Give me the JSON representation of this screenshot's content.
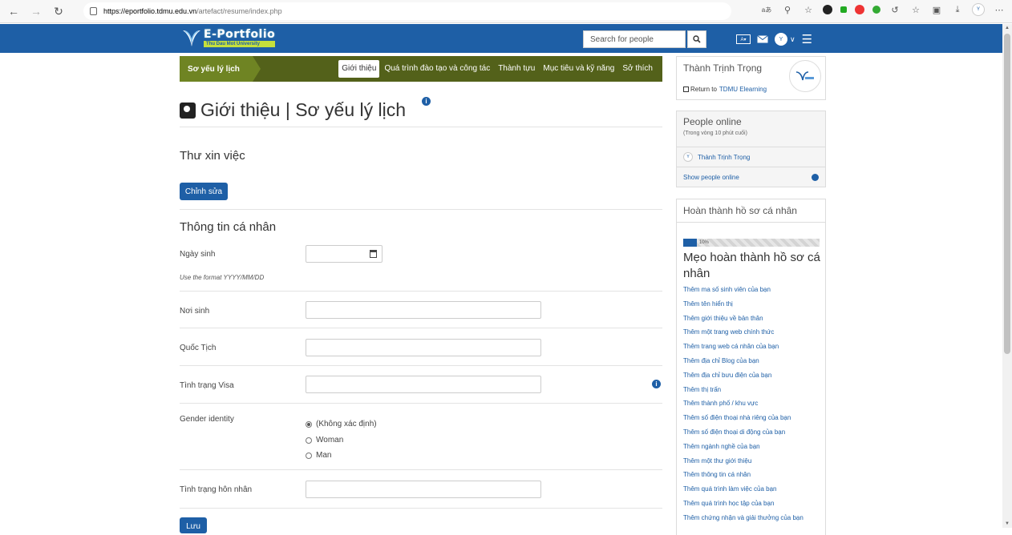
{
  "browser": {
    "url_host": "https://eportfolio.tdmu.edu.vn",
    "url_path": "/artefact/resume/index.php",
    "icons": [
      "back-icon",
      "forward-icon",
      "reload-icon",
      "lock-icon",
      "read-aloud-icon",
      "zoom-icon",
      "star-icon",
      "extensions-icon",
      "favorites-icon",
      "collections-icon",
      "downloads-icon",
      "profile-icon",
      "more-icon"
    ]
  },
  "site": {
    "logo_title": "E-Portfolio",
    "logo_sub": "Thu Dau Mot University",
    "search_placeholder": "Search for people"
  },
  "tabs": {
    "title": "Sơ yếu lý lịch",
    "items": [
      "Giới thiệu",
      "Quá trình đào tạo và công tác",
      "Thành tựu",
      "Mục tiêu và kỹ năng",
      "Sở thích"
    ],
    "active": 0
  },
  "main": {
    "page_title": "Giới thiệu | Sơ yếu lý lịch",
    "cover_letter_heading": "Thư xin việc",
    "edit_label": "Chỉnh sửa",
    "personal_heading": "Thông tin cá nhân",
    "fields": {
      "birthdate_label": "Ngày sinh",
      "birthdate_hint": "Use the format YYYY/MM/DD",
      "birthplace_label": "Nơi sinh",
      "nationality_label": "Quốc Tịch",
      "visa_label": "Tình trạng Visa",
      "gender_label": "Gender identity",
      "gender_options": [
        "(Không xác định)",
        "Woman",
        "Man"
      ],
      "marital_label": "Tình trạng hôn nhân"
    },
    "save_label": "Lưu"
  },
  "sidebar": {
    "user_name": "Thành Trịnh Trọng",
    "return_text": "Return to",
    "return_link": "TDMU Elearning",
    "online_title": "People online",
    "online_sub": "(Trong vòng 10 phút cuối)",
    "online_user": "Thành Trịnh Trọng",
    "show_online": "Show people online",
    "complete_title": "Hoàn thành hồ sơ cá nhân",
    "progress_label": "10%",
    "progress_value": 0.1,
    "tips_title": "Mẹo hoàn thành hồ sơ cá nhân",
    "tips": [
      "Thêm ma số sinh viên của bạn",
      "Thêm tên hiển thị",
      "Thêm giới thiệu về bản thân",
      "Thêm một trang web chính thức",
      "Thêm trang web cá nhân của bạn",
      "Thêm địa chỉ Blog của bạn",
      "Thêm địa chỉ bưu điện của bạn",
      "Thêm thị trấn",
      "Thêm thành phố / khu vực",
      "Thêm số điện thoại nhà riêng của bạn",
      "Thêm số điện thoại di động của bạn",
      "Thêm ngành nghề của bạn",
      "Thêm một thư giới thiệu",
      "Thêm thông tin cá nhân",
      "Thêm quá trình làm việc của bạn",
      "Thêm quá trình học tập của bạn",
      "Thêm chứng nhận và giải thưởng của bạn"
    ]
  },
  "colors": {
    "brand": "#1e5fa6",
    "tabs_bg": "#53611a",
    "tabs_title_bg": "#6f8423"
  }
}
